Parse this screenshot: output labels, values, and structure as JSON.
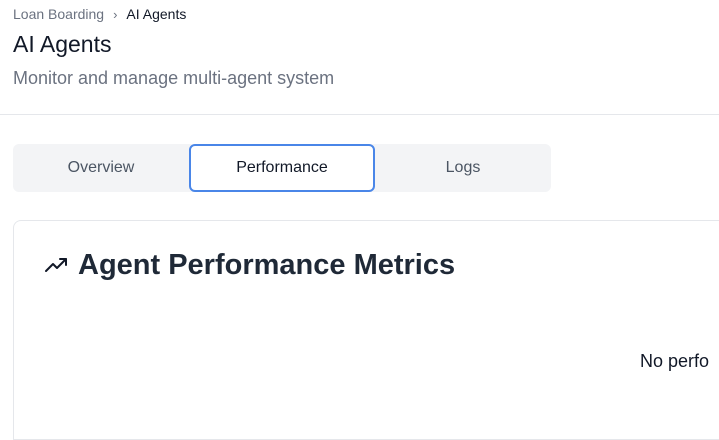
{
  "breadcrumb": {
    "parent": "Loan Boarding",
    "separator": "›",
    "current": "AI Agents"
  },
  "page": {
    "title": "AI Agents",
    "subtitle": "Monitor and manage multi-agent system"
  },
  "tabs": [
    {
      "label": "Overview",
      "active": false
    },
    {
      "label": "Performance",
      "active": true
    },
    {
      "label": "Logs",
      "active": false
    }
  ],
  "card": {
    "icon": "trending-up-icon",
    "title": "Agent Performance Metrics",
    "empty_message": "No perfo"
  },
  "colors": {
    "accent": "#4a86e8",
    "muted_text": "#6b7280",
    "tab_bg": "#f3f4f6"
  }
}
